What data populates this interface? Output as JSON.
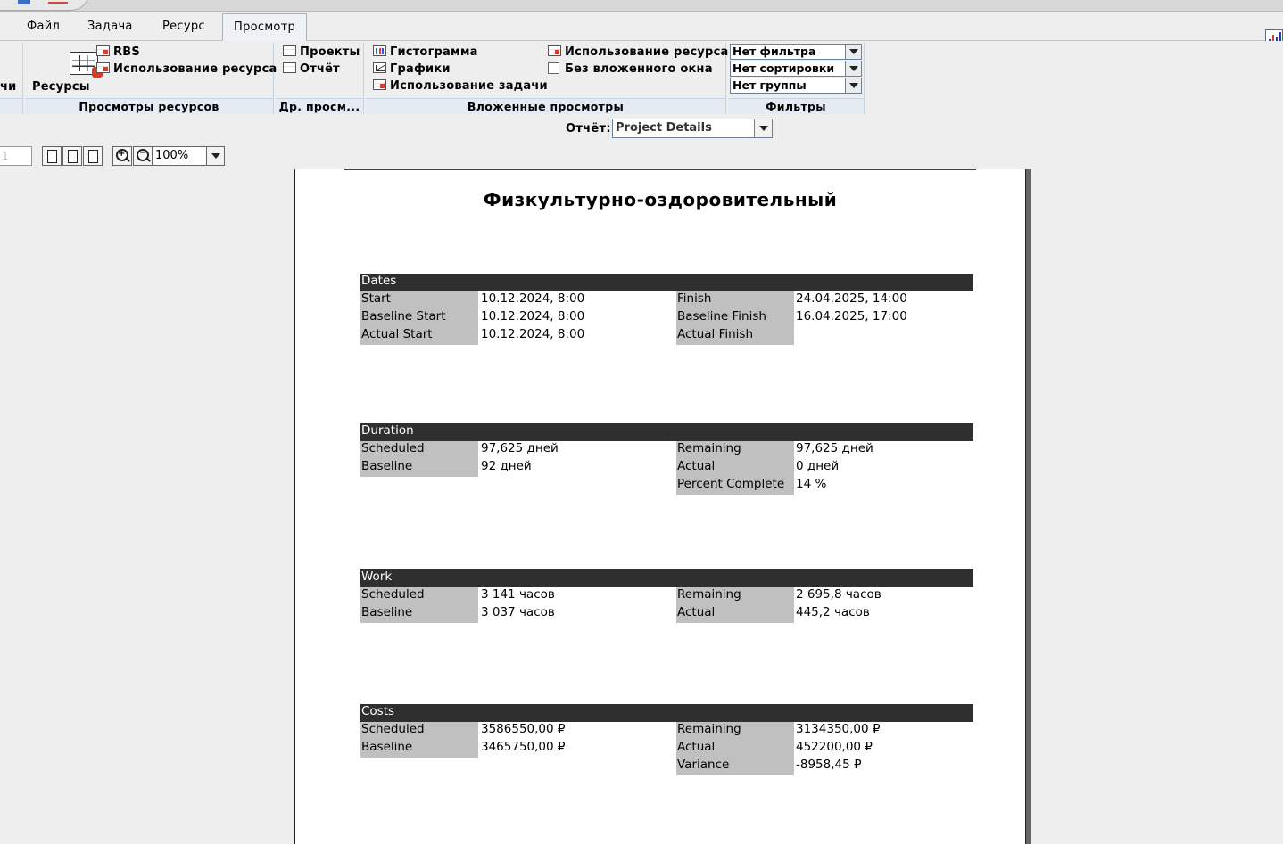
{
  "menu": {
    "partial_left": "чи",
    "tabs": [
      {
        "label": "Файл"
      },
      {
        "label": "Задача"
      },
      {
        "label": "Ресурс"
      },
      {
        "label": "Просмотр",
        "active": true
      }
    ]
  },
  "ribbon": {
    "resources_big_button": "Ресурсы",
    "rbs": "RBS",
    "resource_usage": "Использование ресурса",
    "group_resource_views": "Просмотры ресурсов",
    "projects": "Проекты",
    "report": "Отчёт",
    "group_other_views": "Др. просм...",
    "histogram": "Гистограмма",
    "graphs": "Графики",
    "task_usage": "Использование задачи",
    "resource_usage_2": "Использование ресурса",
    "no_subwindow": "Без вложенного окна",
    "group_nested_views": "Вложенные просмотры",
    "filter": "Нет фильтра",
    "sort": "Нет сортировки",
    "group": "Нет группы",
    "group_filters": "Фильтры"
  },
  "report_bar": {
    "label": "Отчёт:",
    "selected": "Project Details"
  },
  "preview": {
    "page_number": "1",
    "zoom": "100%"
  },
  "report": {
    "title": "Физкультурно-оздоровительный",
    "dates": {
      "header": "Dates",
      "start_label": "Start",
      "start": "10.12.2024, 8:00",
      "finish_label": "Finish",
      "finish": "24.04.2025, 14:00",
      "baseline_start_label": "Baseline Start",
      "baseline_start": "10.12.2024, 8:00",
      "baseline_finish_label": "Baseline Finish",
      "baseline_finish": "16.04.2025, 17:00",
      "actual_start_label": "Actual Start",
      "actual_start": "10.12.2024, 8:00",
      "actual_finish_label": "Actual Finish",
      "actual_finish": ""
    },
    "duration": {
      "header": "Duration",
      "scheduled_label": "Scheduled",
      "scheduled": "97,625 дней",
      "remaining_label": "Remaining",
      "remaining": "97,625 дней",
      "baseline_label": "Baseline",
      "baseline": "92 дней",
      "actual_label": "Actual",
      "actual": "0 дней",
      "percent_label": "Percent Complete",
      "percent": "14 %"
    },
    "work": {
      "header": "Work",
      "scheduled_label": "Scheduled",
      "scheduled": "3 141 часов",
      "remaining_label": "Remaining",
      "remaining": "2 695,8 часов",
      "baseline_label": "Baseline",
      "baseline": "3 037 часов",
      "actual_label": "Actual",
      "actual": "445,2 часов"
    },
    "costs": {
      "header": "Costs",
      "scheduled_label": "Scheduled",
      "scheduled": "3586550,00 ₽",
      "remaining_label": "Remaining",
      "remaining": "3134350,00 ₽",
      "baseline_label": "Baseline",
      "baseline": "3465750,00 ₽",
      "actual_label": "Actual",
      "actual": "452200,00 ₽",
      "variance_label": "Variance",
      "variance": "-8958,45 ₽"
    }
  }
}
